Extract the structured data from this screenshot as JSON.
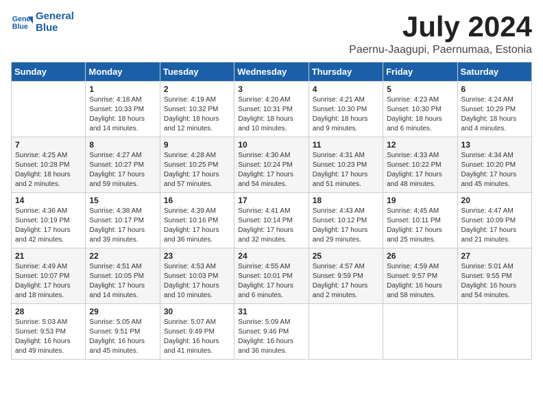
{
  "header": {
    "logo_line1": "General",
    "logo_line2": "Blue",
    "month": "July 2024",
    "location": "Paernu-Jaagupi, Paernumaa, Estonia"
  },
  "days_of_week": [
    "Sunday",
    "Monday",
    "Tuesday",
    "Wednesday",
    "Thursday",
    "Friday",
    "Saturday"
  ],
  "weeks": [
    [
      {
        "day": "",
        "info": ""
      },
      {
        "day": "1",
        "info": "Sunrise: 4:18 AM\nSunset: 10:33 PM\nDaylight: 18 hours\nand 14 minutes."
      },
      {
        "day": "2",
        "info": "Sunrise: 4:19 AM\nSunset: 10:32 PM\nDaylight: 18 hours\nand 12 minutes."
      },
      {
        "day": "3",
        "info": "Sunrise: 4:20 AM\nSunset: 10:31 PM\nDaylight: 18 hours\nand 10 minutes."
      },
      {
        "day": "4",
        "info": "Sunrise: 4:21 AM\nSunset: 10:30 PM\nDaylight: 18 hours\nand 9 minutes."
      },
      {
        "day": "5",
        "info": "Sunrise: 4:23 AM\nSunset: 10:30 PM\nDaylight: 18 hours\nand 6 minutes."
      },
      {
        "day": "6",
        "info": "Sunrise: 4:24 AM\nSunset: 10:29 PM\nDaylight: 18 hours\nand 4 minutes."
      }
    ],
    [
      {
        "day": "7",
        "info": "Sunrise: 4:25 AM\nSunset: 10:28 PM\nDaylight: 18 hours\nand 2 minutes."
      },
      {
        "day": "8",
        "info": "Sunrise: 4:27 AM\nSunset: 10:27 PM\nDaylight: 17 hours\nand 59 minutes."
      },
      {
        "day": "9",
        "info": "Sunrise: 4:28 AM\nSunset: 10:25 PM\nDaylight: 17 hours\nand 57 minutes."
      },
      {
        "day": "10",
        "info": "Sunrise: 4:30 AM\nSunset: 10:24 PM\nDaylight: 17 hours\nand 54 minutes."
      },
      {
        "day": "11",
        "info": "Sunrise: 4:31 AM\nSunset: 10:23 PM\nDaylight: 17 hours\nand 51 minutes."
      },
      {
        "day": "12",
        "info": "Sunrise: 4:33 AM\nSunset: 10:22 PM\nDaylight: 17 hours\nand 48 minutes."
      },
      {
        "day": "13",
        "info": "Sunrise: 4:34 AM\nSunset: 10:20 PM\nDaylight: 17 hours\nand 45 minutes."
      }
    ],
    [
      {
        "day": "14",
        "info": "Sunrise: 4:36 AM\nSunset: 10:19 PM\nDaylight: 17 hours\nand 42 minutes."
      },
      {
        "day": "15",
        "info": "Sunrise: 4:38 AM\nSunset: 10:17 PM\nDaylight: 17 hours\nand 39 minutes."
      },
      {
        "day": "16",
        "info": "Sunrise: 4:39 AM\nSunset: 10:16 PM\nDaylight: 17 hours\nand 36 minutes."
      },
      {
        "day": "17",
        "info": "Sunrise: 4:41 AM\nSunset: 10:14 PM\nDaylight: 17 hours\nand 32 minutes."
      },
      {
        "day": "18",
        "info": "Sunrise: 4:43 AM\nSunset: 10:12 PM\nDaylight: 17 hours\nand 29 minutes."
      },
      {
        "day": "19",
        "info": "Sunrise: 4:45 AM\nSunset: 10:11 PM\nDaylight: 17 hours\nand 25 minutes."
      },
      {
        "day": "20",
        "info": "Sunrise: 4:47 AM\nSunset: 10:09 PM\nDaylight: 17 hours\nand 21 minutes."
      }
    ],
    [
      {
        "day": "21",
        "info": "Sunrise: 4:49 AM\nSunset: 10:07 PM\nDaylight: 17 hours\nand 18 minutes."
      },
      {
        "day": "22",
        "info": "Sunrise: 4:51 AM\nSunset: 10:05 PM\nDaylight: 17 hours\nand 14 minutes."
      },
      {
        "day": "23",
        "info": "Sunrise: 4:53 AM\nSunset: 10:03 PM\nDaylight: 17 hours\nand 10 minutes."
      },
      {
        "day": "24",
        "info": "Sunrise: 4:55 AM\nSunset: 10:01 PM\nDaylight: 17 hours\nand 6 minutes."
      },
      {
        "day": "25",
        "info": "Sunrise: 4:57 AM\nSunset: 9:59 PM\nDaylight: 17 hours\nand 2 minutes."
      },
      {
        "day": "26",
        "info": "Sunrise: 4:59 AM\nSunset: 9:57 PM\nDaylight: 16 hours\nand 58 minutes."
      },
      {
        "day": "27",
        "info": "Sunrise: 5:01 AM\nSunset: 9:55 PM\nDaylight: 16 hours\nand 54 minutes."
      }
    ],
    [
      {
        "day": "28",
        "info": "Sunrise: 5:03 AM\nSunset: 9:53 PM\nDaylight: 16 hours\nand 49 minutes."
      },
      {
        "day": "29",
        "info": "Sunrise: 5:05 AM\nSunset: 9:51 PM\nDaylight: 16 hours\nand 45 minutes."
      },
      {
        "day": "30",
        "info": "Sunrise: 5:07 AM\nSunset: 9:49 PM\nDaylight: 16 hours\nand 41 minutes."
      },
      {
        "day": "31",
        "info": "Sunrise: 5:09 AM\nSunset: 9:46 PM\nDaylight: 16 hours\nand 36 minutes."
      },
      {
        "day": "",
        "info": ""
      },
      {
        "day": "",
        "info": ""
      },
      {
        "day": "",
        "info": ""
      }
    ]
  ]
}
